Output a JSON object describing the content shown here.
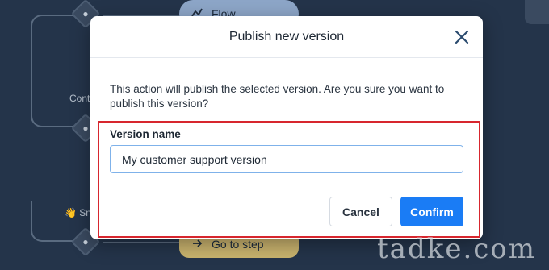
{
  "canvas": {
    "flow_pill_label": "Flow",
    "goto_pill_label": "Go to step",
    "node_label_left": "Cont",
    "node_label_bottom": "Sn",
    "node_label_bottom_emoji": "👋"
  },
  "modal": {
    "title": "Publish new version",
    "message": "This action will publish the selected version. Are you sure you want to publish this version?",
    "field_label": "Version name",
    "input_value": "My customer support version",
    "cancel_label": "Cancel",
    "confirm_label": "Confirm"
  },
  "watermark": "tadke.com",
  "colors": {
    "canvas_bg": "#24344a",
    "confirm_button": "#1a7cf5",
    "highlight_border": "#d7262e",
    "flow_pill": "#8da6c8",
    "goto_pill": "#c9b36e"
  },
  "icons": {
    "close": "close-icon",
    "flow": "flow-icon",
    "goto": "goto-icon"
  }
}
